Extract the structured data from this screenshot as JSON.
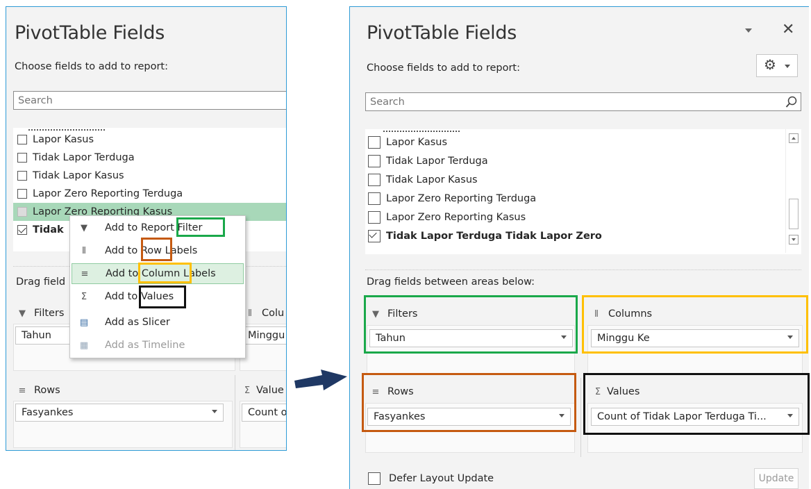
{
  "left_panel": {
    "title": "PivotTable Fields",
    "subtitle": "Choose fields to add to report:",
    "search_placeholder": "Search",
    "fields": [
      {
        "label": "Lapor Kasus",
        "checked": false
      },
      {
        "label": "Tidak Lapor Terduga",
        "checked": false
      },
      {
        "label": "Tidak Lapor Kasus",
        "checked": false
      },
      {
        "label": "Lapor Zero Reporting Terduga",
        "checked": false
      },
      {
        "label": "Lapor Zero Reporting Kasus",
        "checked": false
      },
      {
        "label": "Tidak",
        "checked": true
      }
    ],
    "drag_label": "Drag field",
    "filters_label": "Filters",
    "filters_value": "Tahun",
    "columns_label": "Colu",
    "columns_value": "Minggu",
    "rows_label": "Rows",
    "rows_value": "Fasyankes",
    "values_label": "Value",
    "values_value": "Count o"
  },
  "context_menu": {
    "items": [
      {
        "label": "Add to Report Filter",
        "icon": "filter-icon"
      },
      {
        "label": "Add to Row Labels",
        "icon": "rows-icon"
      },
      {
        "label": "Add to Column Labels",
        "icon": "columns-icon"
      },
      {
        "label": "Add to Values",
        "icon": "sigma-icon"
      },
      {
        "label": "Add as Slicer",
        "icon": "slicer-icon"
      },
      {
        "label": "Add as Timeline",
        "icon": "timeline-icon"
      }
    ]
  },
  "right_panel": {
    "title": "PivotTable Fields",
    "subtitle": "Choose fields to add to report:",
    "search_placeholder": "Search",
    "fields": [
      {
        "label": "Lapor Kasus",
        "checked": false
      },
      {
        "label": "Tidak Lapor Terduga",
        "checked": false
      },
      {
        "label": "Tidak Lapor Kasus",
        "checked": false
      },
      {
        "label": "Lapor Zero Reporting Terduga",
        "checked": false
      },
      {
        "label": "Lapor Zero Reporting Kasus",
        "checked": false
      },
      {
        "label": "Tidak Lapor Terduga Tidak Lapor Zero",
        "checked": true
      }
    ],
    "drag_label": "Drag fields between areas below:",
    "filters_label": "Filters",
    "filters_value": "Tahun",
    "columns_label": "Columns",
    "columns_value": "Minggu Ke",
    "rows_label": "Rows",
    "rows_value": "Fasyankes",
    "values_label": "Values",
    "values_value": "Count of Tidak Lapor Terduga Ti...",
    "defer_label": "Defer Layout Update",
    "update_label": "Update"
  },
  "annotation_colors": {
    "filter": "#1aa84a",
    "rows": "#c55a11",
    "columns": "#ffc000",
    "values": "#111111",
    "arrow": "#1f3864"
  }
}
